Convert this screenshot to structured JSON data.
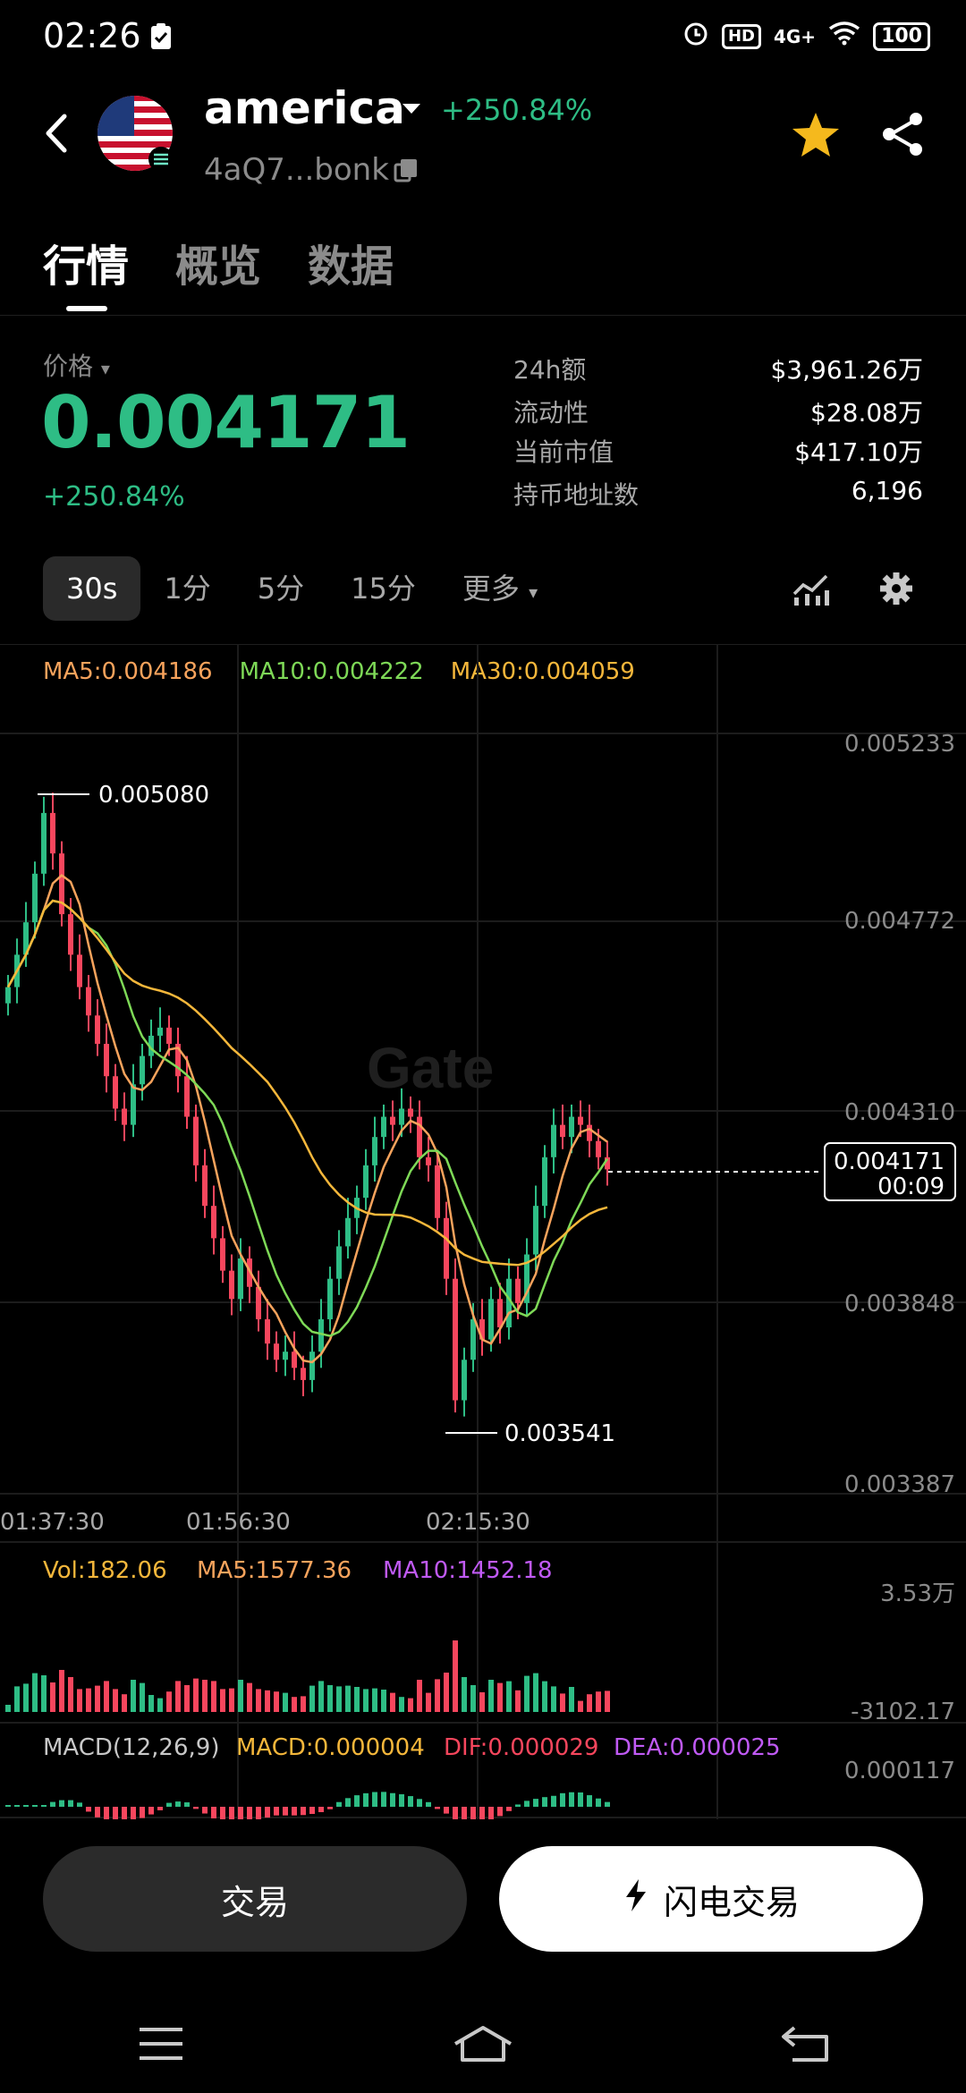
{
  "status_bar": {
    "time": "02:26",
    "network": "4G+",
    "battery": "100",
    "hd": "HD"
  },
  "header": {
    "token_name": "america",
    "change": "+250.84%",
    "address": "4aQ7...bonk"
  },
  "tabs": [
    "行情",
    "概览",
    "数据"
  ],
  "price": {
    "label": "价格",
    "value": "0.004171",
    "change": "+250.84%"
  },
  "stats": [
    {
      "label": "24h额",
      "value": "$3,961.26万"
    },
    {
      "label": "流动性",
      "value": "$28.08万"
    },
    {
      "label": "当前市值",
      "value": "$417.10万"
    },
    {
      "label": "持币地址数",
      "value": "6,196"
    }
  ],
  "intervals": [
    "30s",
    "1分",
    "5分",
    "15分",
    "更多"
  ],
  "ma_legend": {
    "ma5": "MA5:0.004186",
    "ma10": "MA10:0.004222",
    "ma30": "MA30:0.004059"
  },
  "chart_data": {
    "type": "candlestick",
    "y_ticks": [
      "0.005233",
      "0.004772",
      "0.004310",
      "0.003848",
      "0.003387"
    ],
    "x_ticks": [
      "01:37:30",
      "01:56:30",
      "02:15:30"
    ],
    "high_label": "0.005080",
    "low_label": "0.003541",
    "current_price": "0.004171",
    "countdown": "00:09",
    "watermark": "Gate",
    "close_series": [
      0.00462,
      0.0047,
      0.00478,
      0.0049,
      0.00505,
      0.00495,
      0.0048,
      0.0047,
      0.00462,
      0.00455,
      0.00448,
      0.0044,
      0.00432,
      0.00428,
      0.00438,
      0.00445,
      0.0045,
      0.00452,
      0.00448,
      0.0044,
      0.0043,
      0.00418,
      0.00408,
      0.004,
      0.00392,
      0.00385,
      0.00395,
      0.00388,
      0.0038,
      0.00374,
      0.0037,
      0.00372,
      0.00368,
      0.00365,
      0.00372,
      0.0038,
      0.0039,
      0.00398,
      0.00405,
      0.0041,
      0.00418,
      0.00425,
      0.0043,
      0.00428,
      0.00432,
      0.0043,
      0.0042,
      0.00418,
      0.00405,
      0.0039,
      0.0036,
      0.0037,
      0.0038,
      0.00375,
      0.00385,
      0.00378,
      0.0039,
      0.00384,
      0.00396,
      0.00408,
      0.0042,
      0.00428,
      0.00425,
      0.0043,
      0.00428,
      0.00424,
      0.0042,
      0.00417
    ],
    "volume": {
      "label": "Vol:182.06",
      "ma5": "MA5:1577.36",
      "ma10": "MA10:1452.18",
      "top_tick": "3.53万",
      "bottom_tick": "-3102.17"
    },
    "macd": {
      "label": "MACD(12,26,9)",
      "macd": "MACD:0.000004",
      "dif": "DIF:0.000029",
      "dea": "DEA:0.000025",
      "tick": "0.000117"
    }
  },
  "actions": {
    "trade": "交易",
    "flash_trade": "闪电交易"
  },
  "colors": {
    "up": "#2ebd85",
    "down": "#f6465d",
    "ma5": "#f7a35c",
    "ma10": "#7ed957",
    "ma30": "#f5b73b",
    "purple": "#c05af5"
  }
}
